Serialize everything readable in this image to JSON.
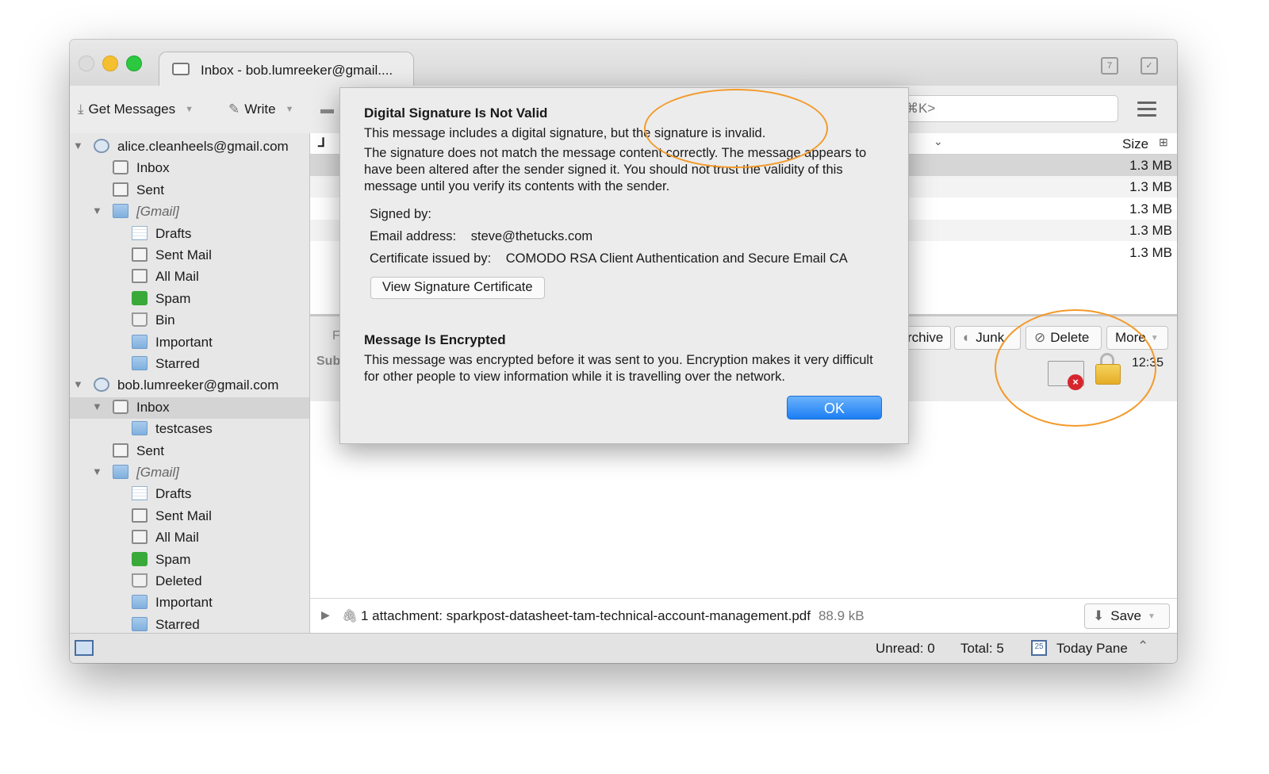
{
  "window": {
    "tab_title": "Inbox - bob.lumreeker@gmail....",
    "calendar_icon_label": "7"
  },
  "toolbar": {
    "get_messages": "Get Messages",
    "write": "Write",
    "search_placeholder": "⌘K>"
  },
  "folders": [
    {
      "label": "alice.cleanheels@gmail.com",
      "icon": "account-icon",
      "level": 0,
      "twisty": true
    },
    {
      "label": "Inbox",
      "icon": "inbox-icon",
      "level": 1
    },
    {
      "label": "Sent",
      "icon": "sent-icon",
      "level": 1
    },
    {
      "label": "[Gmail]",
      "icon": "folder-icon",
      "level": 1,
      "twisty": true,
      "italic": true
    },
    {
      "label": "Drafts",
      "icon": "drafts-icon",
      "level": 2
    },
    {
      "label": "Sent Mail",
      "icon": "sent-icon",
      "level": 2
    },
    {
      "label": "All Mail",
      "icon": "all-mail-icon",
      "level": 2
    },
    {
      "label": "Spam",
      "icon": "spam-icon",
      "level": 2
    },
    {
      "label": "Bin",
      "icon": "bin-icon",
      "level": 2
    },
    {
      "label": "Important",
      "icon": "folder-icon",
      "level": 2
    },
    {
      "label": "Starred",
      "icon": "folder-icon",
      "level": 2
    },
    {
      "label": "bob.lumreeker@gmail.com",
      "icon": "account-icon",
      "level": 0,
      "twisty": true
    },
    {
      "label": "Inbox",
      "icon": "inbox-icon",
      "level": 1,
      "twisty": true,
      "selected": true
    },
    {
      "label": "testcases",
      "icon": "folder-icon",
      "level": 2
    },
    {
      "label": "Sent",
      "icon": "sent-icon",
      "level": 1
    },
    {
      "label": "[Gmail]",
      "icon": "folder-icon",
      "level": 1,
      "twisty": true,
      "italic": true
    },
    {
      "label": "Drafts",
      "icon": "drafts-icon",
      "level": 2
    },
    {
      "label": "Sent Mail",
      "icon": "sent-icon",
      "level": 2
    },
    {
      "label": "All Mail",
      "icon": "all-mail-icon",
      "level": 2
    },
    {
      "label": "Spam",
      "icon": "spam-icon",
      "level": 2
    },
    {
      "label": "Deleted",
      "icon": "bin-icon",
      "level": 2
    },
    {
      "label": "Important",
      "icon": "folder-icon",
      "level": 2
    },
    {
      "label": "Starred",
      "icon": "folder-icon",
      "level": 2
    }
  ],
  "thread": {
    "size_header": "Size",
    "rows": [
      {
        "size": "1.3 MB",
        "selected": true
      },
      {
        "size": "1.3 MB"
      },
      {
        "size": "1.3 MB"
      },
      {
        "size": "1.3 MB"
      },
      {
        "size": "1.3 MB"
      }
    ]
  },
  "header": {
    "archive": "rchive",
    "junk": "Junk",
    "delete": "Delete",
    "more": "More",
    "time": "12:35",
    "left_fragment_1": "F",
    "left_fragment_2": "Sub"
  },
  "attachment": {
    "text": "1 attachment: sparkpost-datasheet-tam-technical-account-management.pdf",
    "size": "88.9 kB",
    "save": "Save"
  },
  "status": {
    "unread": "Unread: 0",
    "total": "Total: 5",
    "today_pane": "Today Pane",
    "calendar_day": "25"
  },
  "dialog": {
    "sig_title": "Digital Signature Is Not Valid",
    "sig_line1": "This message includes a digital signature, but the signature is invalid.",
    "sig_line2": "The signature does not match the message content correctly. The message appears to have been altered after the sender signed it. You should not trust the validity of this message until you verify its contents with the sender.",
    "signed_by_label": "Signed by:",
    "email_label": "Email address:",
    "email_value": "steve@thetucks.com",
    "issuer_label": "Certificate issued by:",
    "issuer_value": "COMODO RSA Client Authentication and Secure Email CA",
    "view_cert_button": "View Signature Certificate",
    "enc_title": "Message Is Encrypted",
    "enc_text": "This message was encrypted before it was sent to you. Encryption makes it very difficult for other people to view information while it is travelling over the network.",
    "ok_button": "OK"
  },
  "colors": {
    "accent_blue": "#1c7ef4",
    "annotation_orange": "#f39a2b",
    "error_red": "#d6262d"
  }
}
